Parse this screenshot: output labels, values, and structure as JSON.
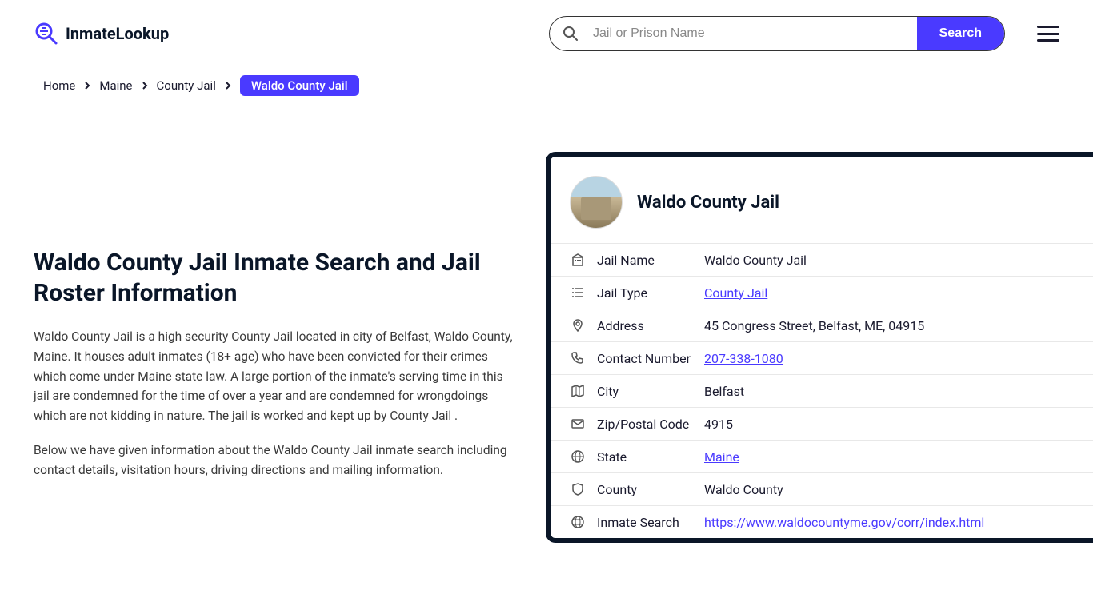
{
  "logo": {
    "text": "InmateLookup"
  },
  "search": {
    "placeholder": "Jail or Prison Name",
    "button": "Search"
  },
  "breadcrumb": {
    "items": [
      "Home",
      "Maine",
      "County Jail"
    ],
    "current": "Waldo County Jail"
  },
  "page": {
    "title": "Waldo County Jail Inmate Search and Jail Roster Information",
    "p1": "Waldo County Jail is a high security County Jail located in city of Belfast, Waldo County, Maine. It houses adult inmates (18+ age) who have been convicted for their crimes which come under Maine state law. A large portion of the inmate's serving time in this jail are condemned for the time of over a year and are condemned for wrongdoings which are not kidding in nature. The jail is worked and kept up by County Jail .",
    "p2": "Below we have given information about the Waldo County Jail inmate search including contact details, visitation hours, driving directions and mailing information."
  },
  "card": {
    "title": "Waldo County Jail",
    "rows": [
      {
        "icon": "building",
        "label": "Jail Name",
        "value": "Waldo County Jail",
        "link": false
      },
      {
        "icon": "list",
        "label": "Jail Type",
        "value": "County Jail",
        "link": true
      },
      {
        "icon": "pin",
        "label": "Address",
        "value": "45 Congress Street, Belfast, ME, 04915",
        "link": false
      },
      {
        "icon": "phone",
        "label": "Contact Number",
        "value": "207-338-1080",
        "link": true
      },
      {
        "icon": "map",
        "label": "City",
        "value": "Belfast",
        "link": false
      },
      {
        "icon": "envelope",
        "label": "Zip/Postal Code",
        "value": "4915",
        "link": false
      },
      {
        "icon": "globe",
        "label": "State",
        "value": "Maine",
        "link": true
      },
      {
        "icon": "badge",
        "label": "County",
        "value": "Waldo County",
        "link": false
      },
      {
        "icon": "web",
        "label": "Inmate Search",
        "value": "https://www.waldocountyme.gov/corr/index.html",
        "link": true
      }
    ]
  }
}
